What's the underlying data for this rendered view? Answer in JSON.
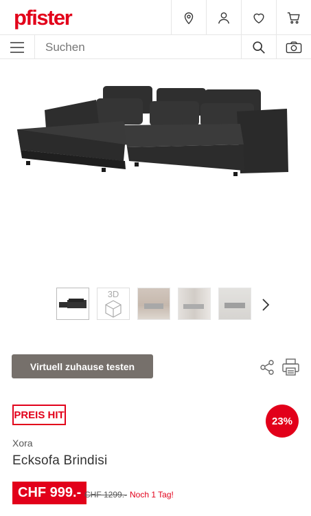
{
  "header": {
    "logo": "pfister",
    "icons": [
      "location-icon",
      "user-icon",
      "heart-icon",
      "cart-icon"
    ]
  },
  "search": {
    "placeholder": "Suchen",
    "icons": [
      "menu-icon",
      "search-icon",
      "camera-icon"
    ]
  },
  "gallery": {
    "thumbnail_count": 5,
    "thumb_3d_label": "3D",
    "next_icon": "chevron-right-icon"
  },
  "actions": {
    "virtual_button": "Virtuell zuhause testen",
    "share_icon": "share-icon",
    "print_icon": "print-icon"
  },
  "badges": {
    "preis_hit": "PREIS HIT",
    "discount": "23%"
  },
  "product": {
    "brand": "Xora",
    "name": "Ecksofa Brindisi",
    "price": "CHF 999.-",
    "old_price": "CHF 1299.-",
    "delivery": "Noch 1 Tag!"
  },
  "colors": {
    "brand_red": "#e2001a",
    "button_grey": "#76706b"
  }
}
